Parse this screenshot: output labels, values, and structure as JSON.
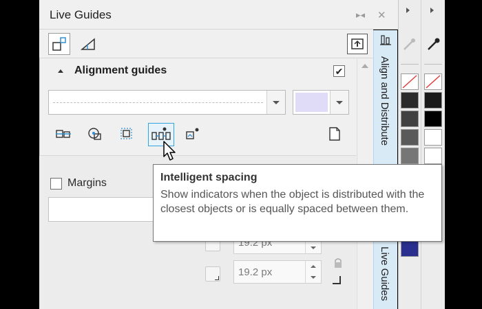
{
  "window": {
    "title": "Live Guides",
    "dock_glyph": "▸◂",
    "close_glyph": "✕"
  },
  "tabs": [
    {
      "name": "alignment-guides-tab",
      "icon": "alignment-guides-icon",
      "active": true
    },
    {
      "name": "dynamic-guides-tab",
      "icon": "dynamic-guides-icon",
      "active": false
    }
  ],
  "section": {
    "title": "Alignment guides",
    "enabled_check": "✔"
  },
  "line_style": {
    "value": ""
  },
  "guide_color": "#e0dcf7",
  "tools": [
    {
      "name": "align-to-object-icon",
      "selected": false
    },
    {
      "name": "align-to-center-icon",
      "selected": false
    },
    {
      "name": "align-to-edges-icon",
      "selected": false
    },
    {
      "name": "intelligent-spacing-icon",
      "selected": true
    },
    {
      "name": "intelligent-dimensioning-icon",
      "selected": false
    }
  ],
  "margins": {
    "label": "Margins"
  },
  "spin_fields": [
    {
      "value": "19.2 px"
    },
    {
      "value": "19.2 px"
    }
  ],
  "side_docker": {
    "tab1": "Align and Distribute",
    "tab2": "Live Guides"
  },
  "tooltip": {
    "title": "Intelligent spacing",
    "body": "Show indicators when the object is distributed with the closest objects or is equally spaced between them."
  },
  "palette": {
    "col1": [
      "none",
      "#2b2b2b",
      "#414141",
      "#5a5a5a",
      "#767676",
      "#939393",
      "#b2b2b2",
      "#d2d2d2",
      "#ffffff",
      "#2a2f8f"
    ],
    "col2": [
      "none",
      "#1a1a1a",
      "#000000",
      "#ffffff",
      "#ffffff",
      "#8b5a3c",
      "#c58f6a",
      "#f08a1e",
      "#bdbdbd"
    ]
  }
}
